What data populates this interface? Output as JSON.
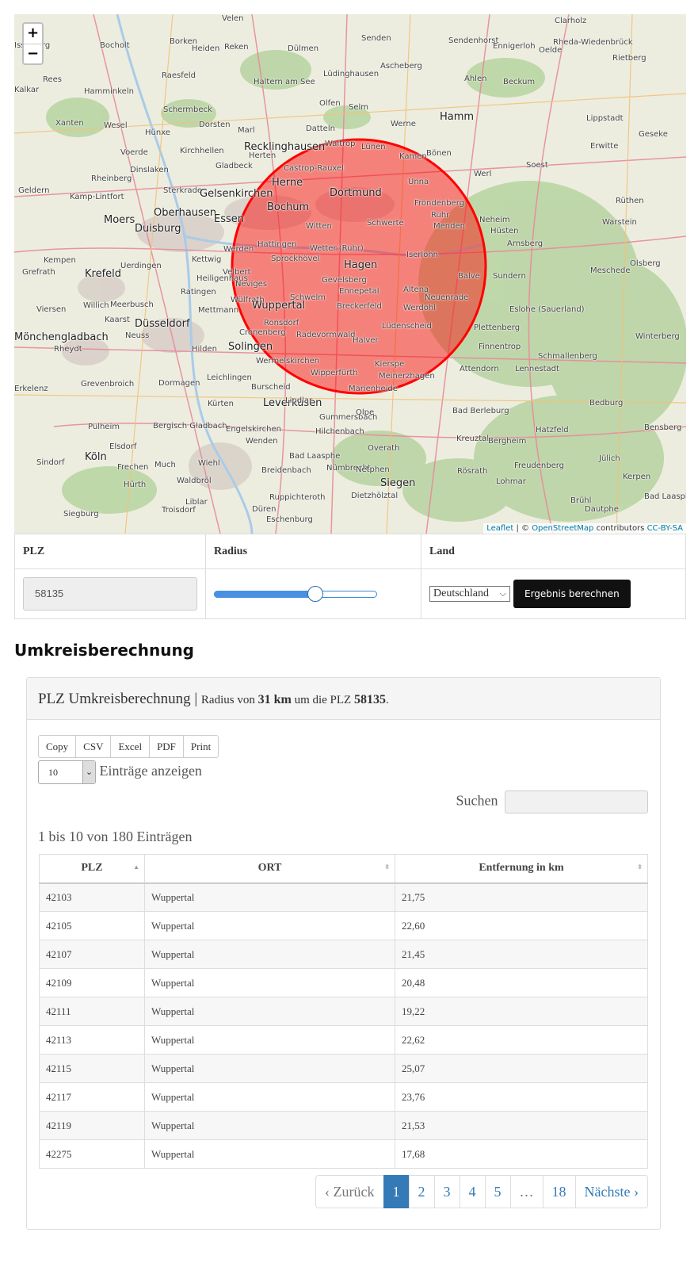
{
  "map": {
    "zoom_in": "+",
    "zoom_out": "−",
    "attribution": {
      "leaflet": "Leaflet",
      "sep": " | © ",
      "osm": "OpenStreetMap",
      "contrib": " contributors ",
      "license": "CC-BY-SA"
    },
    "circle_color": "#ff0000",
    "towns": [
      {
        "name": "Velen"
      },
      {
        "name": "Senden"
      },
      {
        "name": "Sendenhorst"
      },
      {
        "name": "Clarholz"
      },
      {
        "name": "Isselburg"
      },
      {
        "name": "Bocholt"
      },
      {
        "name": "Borken"
      },
      {
        "name": "Heiden"
      },
      {
        "name": "Reken"
      },
      {
        "name": "Dülmen"
      },
      {
        "name": "Ennigerloh"
      },
      {
        "name": "Oelde"
      },
      {
        "name": "Rheda-Wiedenbrück"
      },
      {
        "name": "Rietberg"
      },
      {
        "name": "Ascheberg"
      },
      {
        "name": "Lüdinghausen"
      },
      {
        "name": "Raesfeld"
      },
      {
        "name": "Haltern am See"
      },
      {
        "name": "Ahlen"
      },
      {
        "name": "Beckum"
      },
      {
        "name": "Rees"
      },
      {
        "name": "Kalkar"
      },
      {
        "name": "Hamminkeln"
      },
      {
        "name": "Olfen"
      },
      {
        "name": "Selm"
      },
      {
        "name": "Schermbeck"
      },
      {
        "name": "Hamm"
      },
      {
        "name": "Lippstadt"
      },
      {
        "name": "Xanten"
      },
      {
        "name": "Wesel"
      },
      {
        "name": "Hünxe"
      },
      {
        "name": "Dorsten"
      },
      {
        "name": "Marl"
      },
      {
        "name": "Datteln"
      },
      {
        "name": "Werne"
      },
      {
        "name": "Geseke"
      },
      {
        "name": "Recklinghausen"
      },
      {
        "name": "Herten"
      },
      {
        "name": "Waltrop"
      },
      {
        "name": "Lünen"
      },
      {
        "name": "Kamen"
      },
      {
        "name": "Bönen"
      },
      {
        "name": "Erwitte"
      },
      {
        "name": "Voerde"
      },
      {
        "name": "Kirchhellen"
      },
      {
        "name": "Gladbeck"
      },
      {
        "name": "Soest"
      },
      {
        "name": "Dinslaken"
      },
      {
        "name": "Rheinberg"
      },
      {
        "name": "Castrop-Rauxel"
      },
      {
        "name": "Werl"
      },
      {
        "name": "Geldern"
      },
      {
        "name": "Sterkrade"
      },
      {
        "name": "Herne"
      },
      {
        "name": "Dortmund"
      },
      {
        "name": "Unna"
      },
      {
        "name": "Kamp-Lintfort"
      },
      {
        "name": "Gelsenkirchen"
      },
      {
        "name": "Rüthen"
      },
      {
        "name": "Moers"
      },
      {
        "name": "Oberhausen"
      },
      {
        "name": "Bochum"
      },
      {
        "name": "Fröndenberg"
      },
      {
        "name": "Duisburg"
      },
      {
        "name": "Essen"
      },
      {
        "name": "Ruhr"
      },
      {
        "name": "Neheim"
      },
      {
        "name": "Warstein"
      },
      {
        "name": "Witten"
      },
      {
        "name": "Schwerte"
      },
      {
        "name": "Menden"
      },
      {
        "name": "Hüsten"
      },
      {
        "name": "Hattingen"
      },
      {
        "name": "Arnsberg"
      },
      {
        "name": "Kempen"
      },
      {
        "name": "Uerdingen"
      },
      {
        "name": "Wetter (Ruhr)"
      },
      {
        "name": "Iserlohn"
      },
      {
        "name": "Olsberg"
      },
      {
        "name": "Kettwig"
      },
      {
        "name": "Sprockhövel"
      },
      {
        "name": "Hagen"
      },
      {
        "name": "Krefeld"
      },
      {
        "name": "Grefrath"
      },
      {
        "name": "Velbert"
      },
      {
        "name": "Werden"
      },
      {
        "name": "Meschede"
      },
      {
        "name": "Heiligenhaus"
      },
      {
        "name": "Gevelsberg"
      },
      {
        "name": "Balve"
      },
      {
        "name": "Sundern"
      },
      {
        "name": "Ratingen"
      },
      {
        "name": "Neviges"
      },
      {
        "name": "Ennepetal"
      },
      {
        "name": "Altena"
      },
      {
        "name": "Willich"
      },
      {
        "name": "Meerbusch"
      },
      {
        "name": "Wülfrath"
      },
      {
        "name": "Schwelm"
      },
      {
        "name": "Neuenrade"
      },
      {
        "name": "Viersen"
      },
      {
        "name": "Mettmann"
      },
      {
        "name": "Wuppertal"
      },
      {
        "name": "Breckerfeld"
      },
      {
        "name": "Werdohl"
      },
      {
        "name": "Eslohe (Sauerland)"
      },
      {
        "name": "Kaarst"
      },
      {
        "name": "Düsseldorf"
      },
      {
        "name": "Ronsdorf"
      },
      {
        "name": "Plettenberg"
      },
      {
        "name": "Mönchengladbach"
      },
      {
        "name": "Neuss"
      },
      {
        "name": "Cronenberg"
      },
      {
        "name": "Radevormwald"
      },
      {
        "name": "Lüdenscheid"
      },
      {
        "name": "Winterberg"
      },
      {
        "name": "Rheydt"
      },
      {
        "name": "Hilden"
      },
      {
        "name": "Solingen"
      },
      {
        "name": "Halver"
      },
      {
        "name": "Finnentrop"
      },
      {
        "name": "Schmallenberg"
      },
      {
        "name": "Wermelskirchen"
      },
      {
        "name": "Kierspe"
      },
      {
        "name": "Attendorn"
      },
      {
        "name": "Lennestadt"
      },
      {
        "name": "Leichlingen"
      },
      {
        "name": "Wipperfürth"
      },
      {
        "name": "Meinerzhagen"
      },
      {
        "name": "Erkelenz"
      },
      {
        "name": "Grevenbroich"
      },
      {
        "name": "Dormagen"
      },
      {
        "name": "Burscheid"
      },
      {
        "name": "Marienheide"
      },
      {
        "name": "Leverkusen"
      },
      {
        "name": "Kürten"
      },
      {
        "name": "Lindlar"
      },
      {
        "name": "Gummersbach"
      },
      {
        "name": "Olpe"
      },
      {
        "name": "Bad Berleburg"
      },
      {
        "name": "Bedburg"
      },
      {
        "name": "Pulheim"
      },
      {
        "name": "Bergisch Gladbach"
      },
      {
        "name": "Engelskirchen"
      },
      {
        "name": "Hilchenbach"
      },
      {
        "name": "Hatzfeld"
      },
      {
        "name": "Bensberg"
      },
      {
        "name": "Wenden"
      },
      {
        "name": "Kreuztal"
      },
      {
        "name": "Bergheim"
      },
      {
        "name": "Elsdorf"
      },
      {
        "name": "Köln"
      },
      {
        "name": "Wiehl"
      },
      {
        "name": "Overath"
      },
      {
        "name": "Bad Laasphe"
      },
      {
        "name": "Jülich"
      },
      {
        "name": "Sindorf"
      },
      {
        "name": "Frechen"
      },
      {
        "name": "Much"
      },
      {
        "name": "Nümbrecht"
      },
      {
        "name": "Netphen"
      },
      {
        "name": "Freudenberg"
      },
      {
        "name": "Rösrath"
      },
      {
        "name": "Breidenbach"
      },
      {
        "name": "Kerpen"
      },
      {
        "name": "Hürth"
      },
      {
        "name": "Waldbröl"
      },
      {
        "name": "Siegen"
      },
      {
        "name": "Lohmar"
      },
      {
        "name": "Ruppichteroth"
      },
      {
        "name": "Dietzhölztal"
      },
      {
        "name": "Brühl"
      },
      {
        "name": "Liblar"
      },
      {
        "name": "Troisdorf"
      },
      {
        "name": "Düren"
      },
      {
        "name": "Siegburg"
      },
      {
        "name": "Eschenburg"
      },
      {
        "name": "Dautphe"
      },
      {
        "name": "Bad Laasphe"
      }
    ]
  },
  "form": {
    "plz_label": "PLZ",
    "radius_label": "Radius",
    "land_label": "Land",
    "plz_value": "58135",
    "radius_fraction": 0.62,
    "land_value": "Deutschland",
    "land_chevron": "⌵",
    "submit_label": "Ergebnis berechnen"
  },
  "section_title": "Umkreisberechnung",
  "panel": {
    "title": "PLZ Umkreisberechnung",
    "separator": " | ",
    "prefix": "Radius von ",
    "radius": "31 km",
    "middle": " um die PLZ ",
    "plz": "58135",
    "suffix": "."
  },
  "export_buttons": [
    "Copy",
    "CSV",
    "Excel",
    "PDF",
    "Print"
  ],
  "length": {
    "value": "10",
    "chevron": "⌄",
    "label": "Einträge anzeigen"
  },
  "search_label": "Suchen",
  "info_text": "1 bis 10 von 180 Einträgen",
  "table": {
    "columns": [
      "PLZ",
      "ORT",
      "Entfernung in km"
    ],
    "sort_up": "▲",
    "sort_both": "⬍",
    "rows": [
      [
        "42103",
        "Wuppertal",
        "21,75"
      ],
      [
        "42105",
        "Wuppertal",
        "22,60"
      ],
      [
        "42107",
        "Wuppertal",
        "21,45"
      ],
      [
        "42109",
        "Wuppertal",
        "20,48"
      ],
      [
        "42111",
        "Wuppertal",
        "19,22"
      ],
      [
        "42113",
        "Wuppertal",
        "22,62"
      ],
      [
        "42115",
        "Wuppertal",
        "25,07"
      ],
      [
        "42117",
        "Wuppertal",
        "23,76"
      ],
      [
        "42119",
        "Wuppertal",
        "21,53"
      ],
      [
        "42275",
        "Wuppertal",
        "17,68"
      ]
    ]
  },
  "pagination": [
    "‹ Zurück",
    "1",
    "2",
    "3",
    "4",
    "5",
    "…",
    "18",
    "Nächste ›"
  ]
}
